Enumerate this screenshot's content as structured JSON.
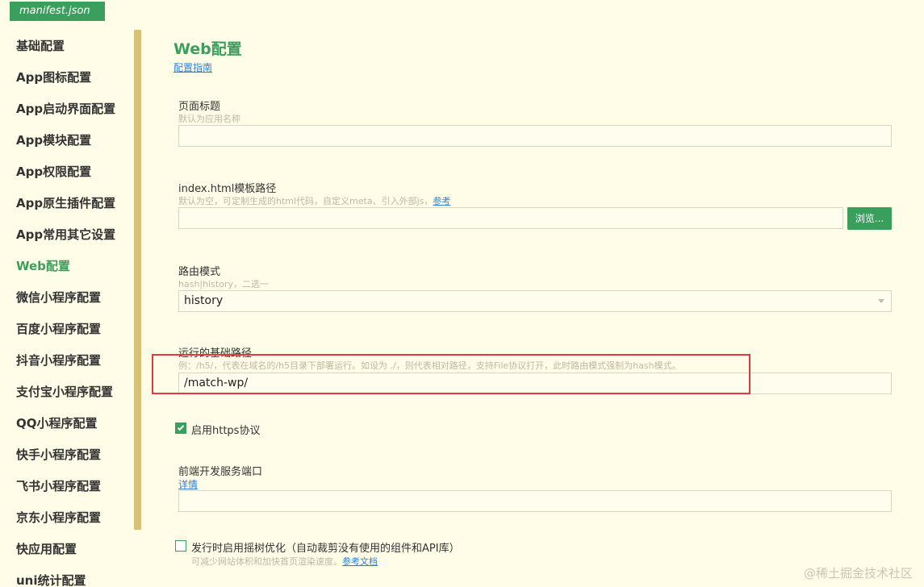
{
  "tab": {
    "label": "manifest.json"
  },
  "sidebar": {
    "items": [
      {
        "label": "基础配置",
        "active": false
      },
      {
        "label": "App图标配置",
        "active": false
      },
      {
        "label": "App启动界面配置",
        "active": false
      },
      {
        "label": "App模块配置",
        "active": false
      },
      {
        "label": "App权限配置",
        "active": false
      },
      {
        "label": "App原生插件配置",
        "active": false
      },
      {
        "label": "App常用其它设置",
        "active": false
      },
      {
        "label": "Web配置",
        "active": true
      },
      {
        "label": "微信小程序配置",
        "active": false
      },
      {
        "label": "百度小程序配置",
        "active": false
      },
      {
        "label": "抖音小程序配置",
        "active": false
      },
      {
        "label": "支付宝小程序配置",
        "active": false
      },
      {
        "label": "QQ小程序配置",
        "active": false
      },
      {
        "label": "快手小程序配置",
        "active": false
      },
      {
        "label": "飞书小程序配置",
        "active": false
      },
      {
        "label": "京东小程序配置",
        "active": false
      },
      {
        "label": "快应用配置",
        "active": false
      },
      {
        "label": "uni统计配置",
        "active": false
      }
    ]
  },
  "main": {
    "title": "Web配置",
    "guide_link": "配置指南",
    "page_title_field": {
      "label": "页面标题",
      "hint": "默认为应用名称",
      "value": ""
    },
    "template_field": {
      "label": "index.html模板路径",
      "hint": "默认为空，可定制生成的html代码，自定义meta、引入外部js，",
      "hint_link": "参考",
      "value": "",
      "browse_label": "浏览..."
    },
    "router_field": {
      "label": "路由模式",
      "hint": "hash|history，二选一",
      "value": "history"
    },
    "base_path_field": {
      "label": "运行的基础路径",
      "hint": "例：/h5/，代表在域名的/h5目录下部署运行。如设为 ./，则代表相对路径，支持File协议打开，此时路由模式强制为hash模式。",
      "value": "/match-wp/"
    },
    "https_option": {
      "label": "启用https协议",
      "checked": true
    },
    "port_field": {
      "label": "前端开发服务端口",
      "link": "详情",
      "value": ""
    },
    "treeshake_option": {
      "label": "发行时启用摇树优化（自动裁剪没有使用的组件和API库）",
      "checked": false,
      "hint": "可减少网站体积和加快首页渲染速度。",
      "hint_link": "参考文档"
    }
  },
  "watermark": "@稀土掘金技术社区",
  "colors": {
    "accent": "#3a9f5c",
    "background": "#fffde8",
    "rail": "#d7c172",
    "highlight": "#e0393e",
    "link": "#2f7fd6"
  }
}
